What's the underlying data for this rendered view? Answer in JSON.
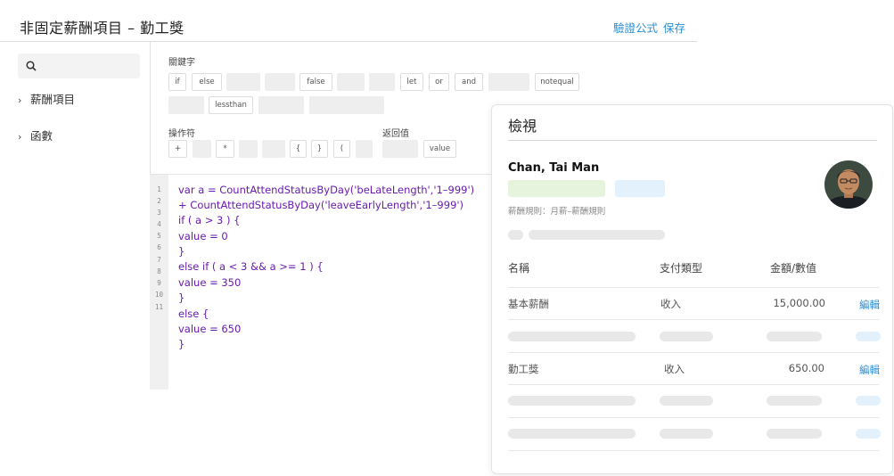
{
  "header": {
    "title": "非固定薪酬項目 – 勤工獎",
    "validate_label": "驗證公式",
    "save_label": "保存"
  },
  "sidebar": {
    "items": [
      {
        "label": "薪酬項目"
      },
      {
        "label": "函數"
      }
    ]
  },
  "keywords": {
    "label": "關鍵字",
    "chips": [
      "if",
      "else",
      "false",
      "let",
      "or",
      "and",
      "notequal",
      "lessthan"
    ]
  },
  "operators": {
    "label": "操作符",
    "chips": [
      "+",
      "*",
      "{",
      "}",
      "("
    ]
  },
  "return_value": {
    "label": "返回值",
    "chips": [
      "value"
    ]
  },
  "editor": {
    "line_numbers": [
      "1",
      "2",
      "3",
      "4",
      "5",
      "6",
      "7",
      "8",
      "9",
      "10",
      "11"
    ],
    "lines": [
      "var a = CountAttendStatusByDay('beLateLength','1–999')",
      "+ CountAttendStatusByDay('leaveEarlyLength','1–999')",
      "if ( a > 3 ) {",
      "value = 0",
      "}",
      "else if ( a < 3 && a >= 1 ) {",
      "value = 350",
      "}",
      "else {",
      "value = 650",
      "}"
    ]
  },
  "preview": {
    "title": "檢視",
    "employee_name": "Chan, Tai Man",
    "rule_text": "薪酬規則：月薪–薪酬規則",
    "columns": [
      "名稱",
      "支付類型",
      "金額/數值"
    ],
    "rows": [
      {
        "name": "基本薪酬",
        "type": "收入",
        "amount": "15,000.00",
        "action": "編輯"
      },
      {
        "name": "勤工獎",
        "type": "收入",
        "amount": "650.00",
        "action": "編輯"
      }
    ]
  },
  "colors": {
    "accent": "#2b8fd6",
    "code": "#6a1bb0",
    "pill_green": "#e6f4dd",
    "pill_blue": "#e3f1fc"
  }
}
